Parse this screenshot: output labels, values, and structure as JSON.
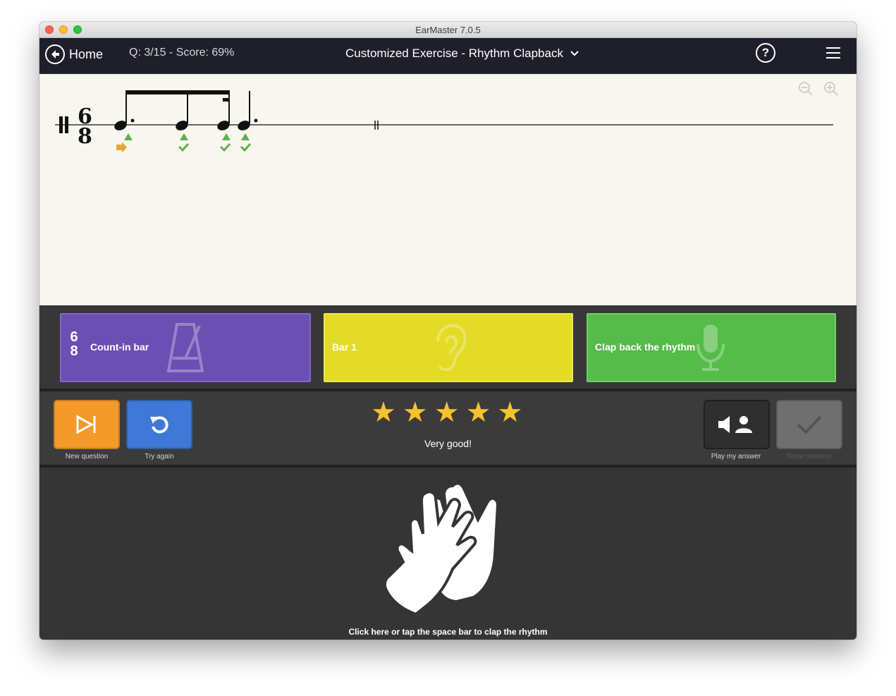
{
  "window": {
    "title": "EarMaster 7.0.5"
  },
  "appbar": {
    "home_label": "Home",
    "question_score": "Q: 3/15 - Score: 69%",
    "exercise_title": "Customized Exercise - Rhythm Clapback",
    "help_label": "?",
    "progress": {
      "total_segments": 15,
      "completed_segments": 3,
      "segment_colors": [
        "#dcd52c",
        "#dcd52c",
        "#5db84a"
      ]
    }
  },
  "score": {
    "time_signature": {
      "top": "6",
      "bottom": "8"
    }
  },
  "steps": {
    "count_in": {
      "label": "Count-in bar",
      "ts_top": "6",
      "ts_bottom": "8",
      "icon": "metronome-icon",
      "color": "#6c4fb2"
    },
    "bar1": {
      "label": "Bar 1",
      "icon": "ear-icon",
      "color": "#e3db26"
    },
    "clap": {
      "label": "Clap back the rhythm",
      "icon": "microphone-icon",
      "color": "#55bb49"
    }
  },
  "controls": {
    "new_question": {
      "caption": "New question",
      "icon": "skip-forward-icon",
      "color": "#f39a2b"
    },
    "try_again": {
      "caption": "Try again",
      "icon": "replay-icon",
      "color": "#3f78d6"
    },
    "rating": {
      "stars": 5,
      "text": "Very good!"
    },
    "play_my_answer": {
      "caption": "Play my answer",
      "icon": "speaker-person-icon"
    },
    "show_notation": {
      "caption": "Show notation",
      "icon": "checkmark-icon",
      "enabled": false
    }
  },
  "clap_area": {
    "instruction": "Click here or tap the space bar to clap the rhythm",
    "icon": "clapping-hands-icon"
  }
}
